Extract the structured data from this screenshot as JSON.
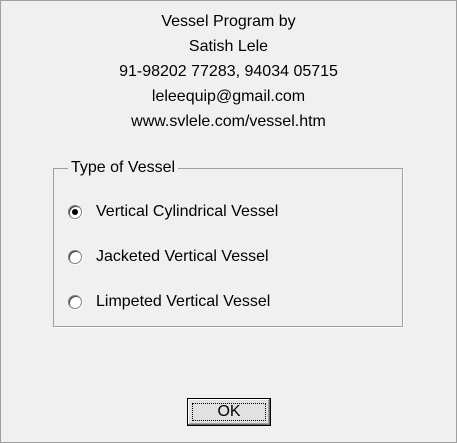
{
  "header": {
    "lines": [
      "Vessel Program by",
      "Satish Lele",
      "91-98202 77283, 94034 05715",
      "leleequip@gmail.com",
      "www.svlele.com/vessel.htm"
    ]
  },
  "group": {
    "legend": "Type of Vessel",
    "options": [
      {
        "label": "Vertical Cylindrical Vessel",
        "checked": true
      },
      {
        "label": "Jacketed Vertical Vessel",
        "checked": false
      },
      {
        "label": "Limpeted Vertical Vessel",
        "checked": false
      }
    ]
  },
  "buttons": {
    "ok_label": "OK"
  }
}
